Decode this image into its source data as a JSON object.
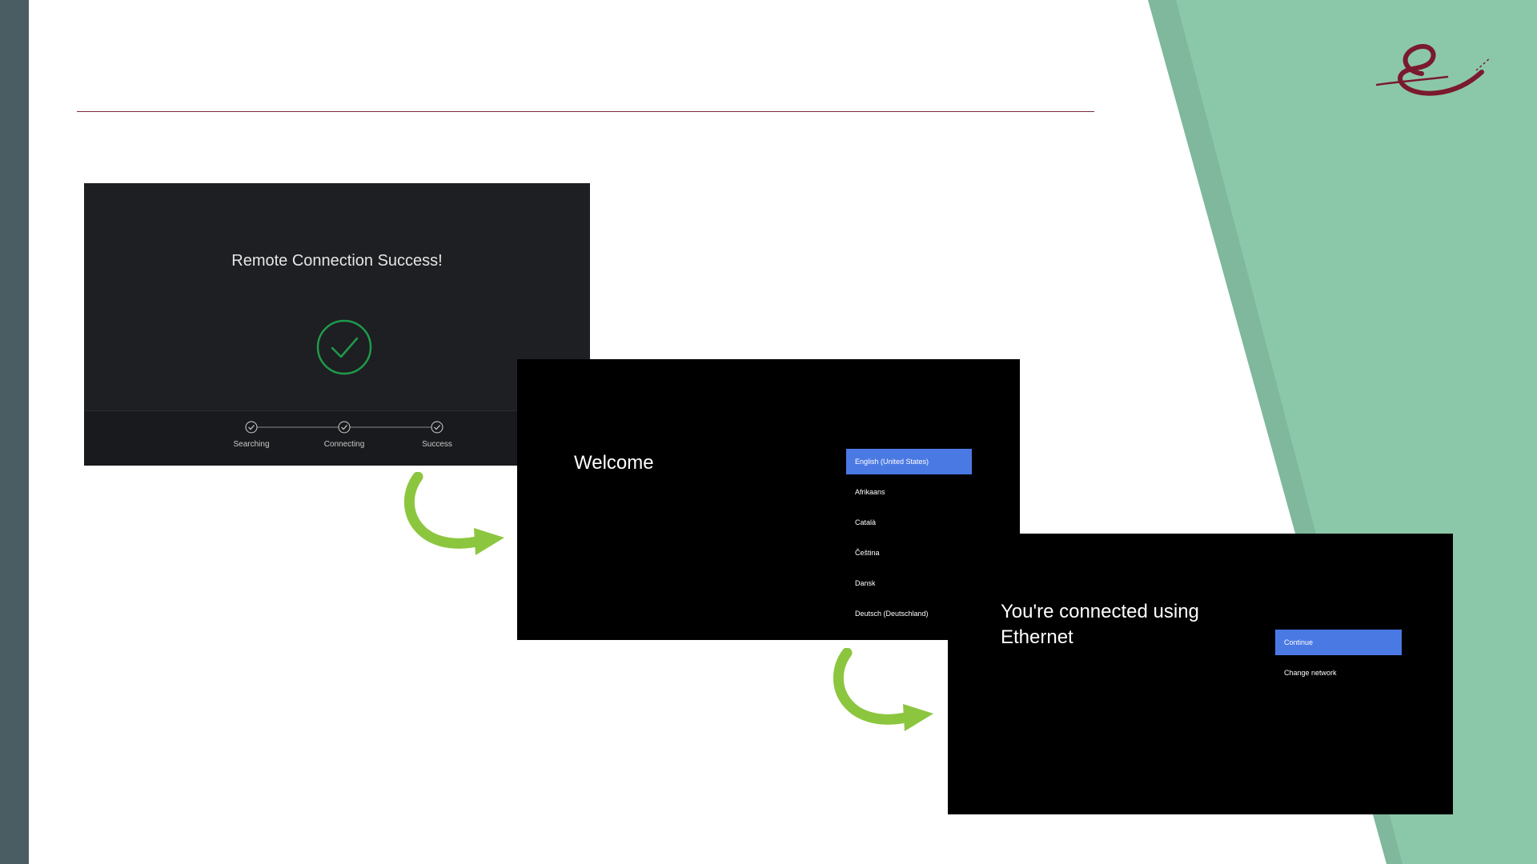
{
  "colors": {
    "sidebar": "#4a5d63",
    "teal_light": "#8bc8aa",
    "teal_dark": "#7fb89c",
    "rule": "#7a2a3a",
    "logo": "#7a1a2e",
    "success_green": "#1f9a4a",
    "selected_blue": "#4b79e4",
    "arrow_green": "#8cc63f"
  },
  "icons": {
    "logo": "script-e-logo",
    "check": "check-circle-icon",
    "step": "step-check-icon",
    "arrow": "curved-arrow-icon"
  },
  "remote_screen": {
    "title": "Remote Connection Success!",
    "steps": [
      {
        "label": "Searching"
      },
      {
        "label": "Connecting"
      },
      {
        "label": "Success"
      }
    ]
  },
  "welcome_screen": {
    "title": "Welcome",
    "languages": [
      {
        "label": "English (United States)",
        "selected": true
      },
      {
        "label": "Afrikaans",
        "selected": false
      },
      {
        "label": "Català",
        "selected": false
      },
      {
        "label": "Čeština",
        "selected": false
      },
      {
        "label": "Dansk",
        "selected": false
      },
      {
        "label": "Deutsch (Deutschland)",
        "selected": false
      }
    ]
  },
  "network_screen": {
    "title": "You're connected using Ethernet",
    "options": [
      {
        "label": "Continue",
        "selected": true
      },
      {
        "label": "Change network",
        "selected": false
      }
    ]
  }
}
